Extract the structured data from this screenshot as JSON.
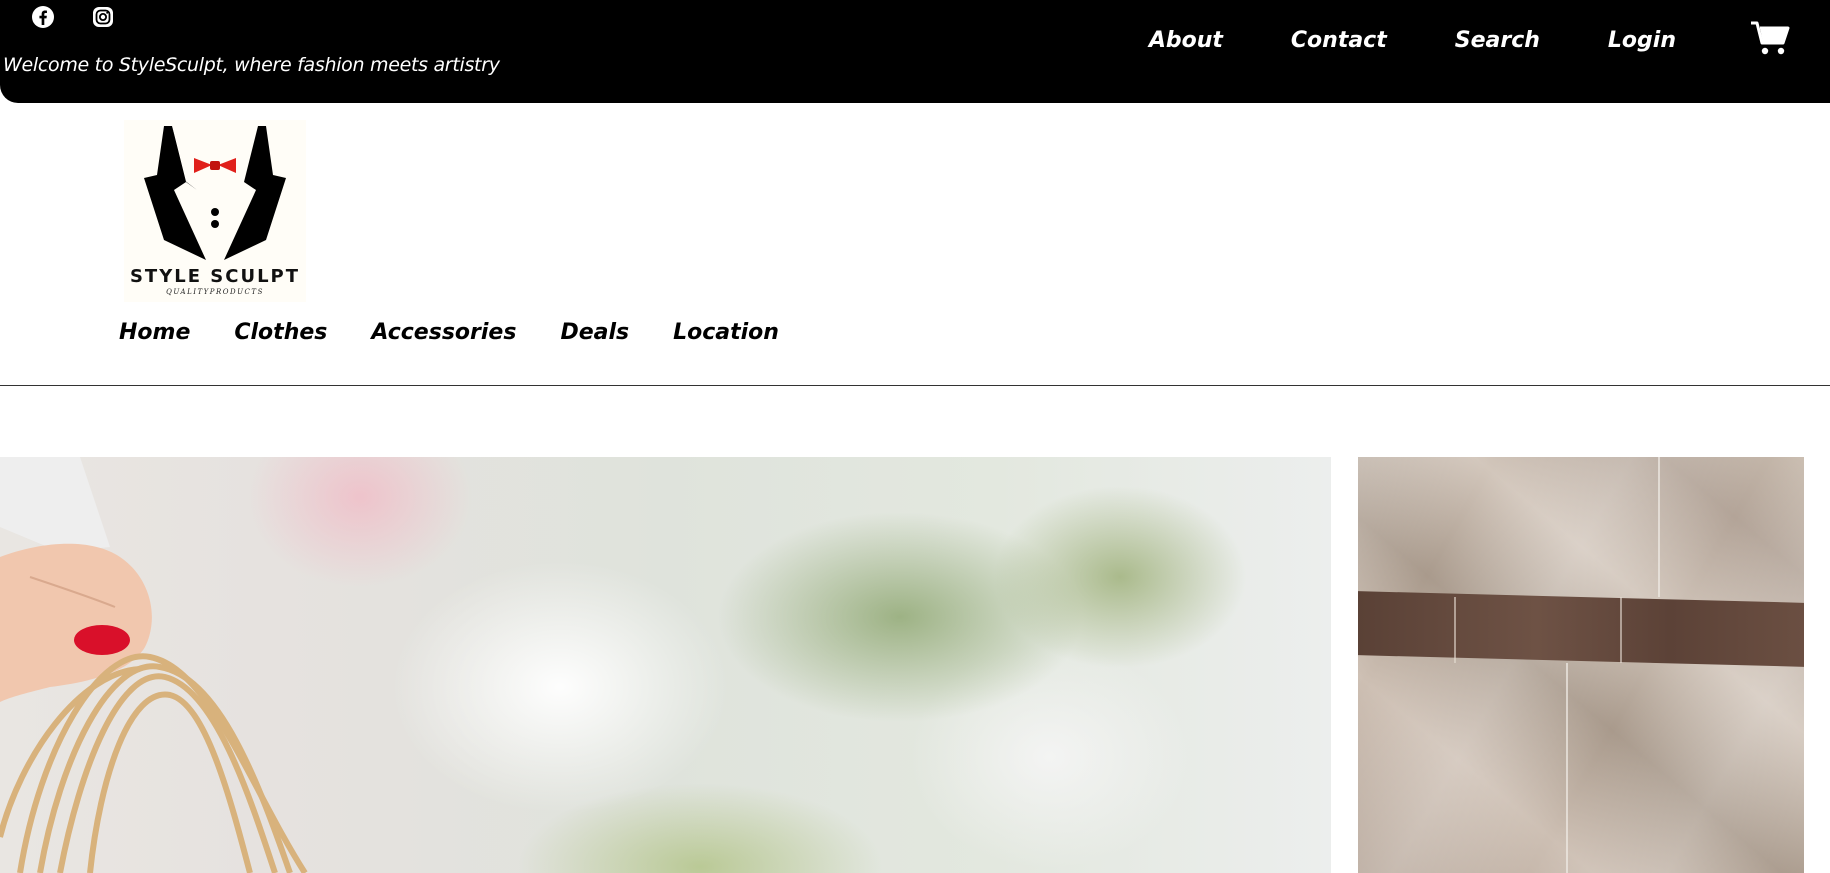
{
  "topbar": {
    "social": [
      {
        "icon": "facebook-icon"
      },
      {
        "icon": "instagram-icon"
      }
    ],
    "welcome": "Welcome to StyleSculpt, where fashion meets artistry",
    "nav": [
      "About",
      "Contact",
      "Search",
      "Login"
    ],
    "cart_icon": "cart-icon"
  },
  "logo": {
    "title": "STYLE SCULPT",
    "subtitle": "QUALITYPRODUCTS",
    "bowtie_color": "#e0201b"
  },
  "mainnav": [
    "Home",
    "Clothes",
    "Accessories",
    "Deals",
    "Location"
  ],
  "colors": {
    "topbar_bg": "#000000",
    "text_light": "#ffffff",
    "text_dark": "#000000"
  }
}
